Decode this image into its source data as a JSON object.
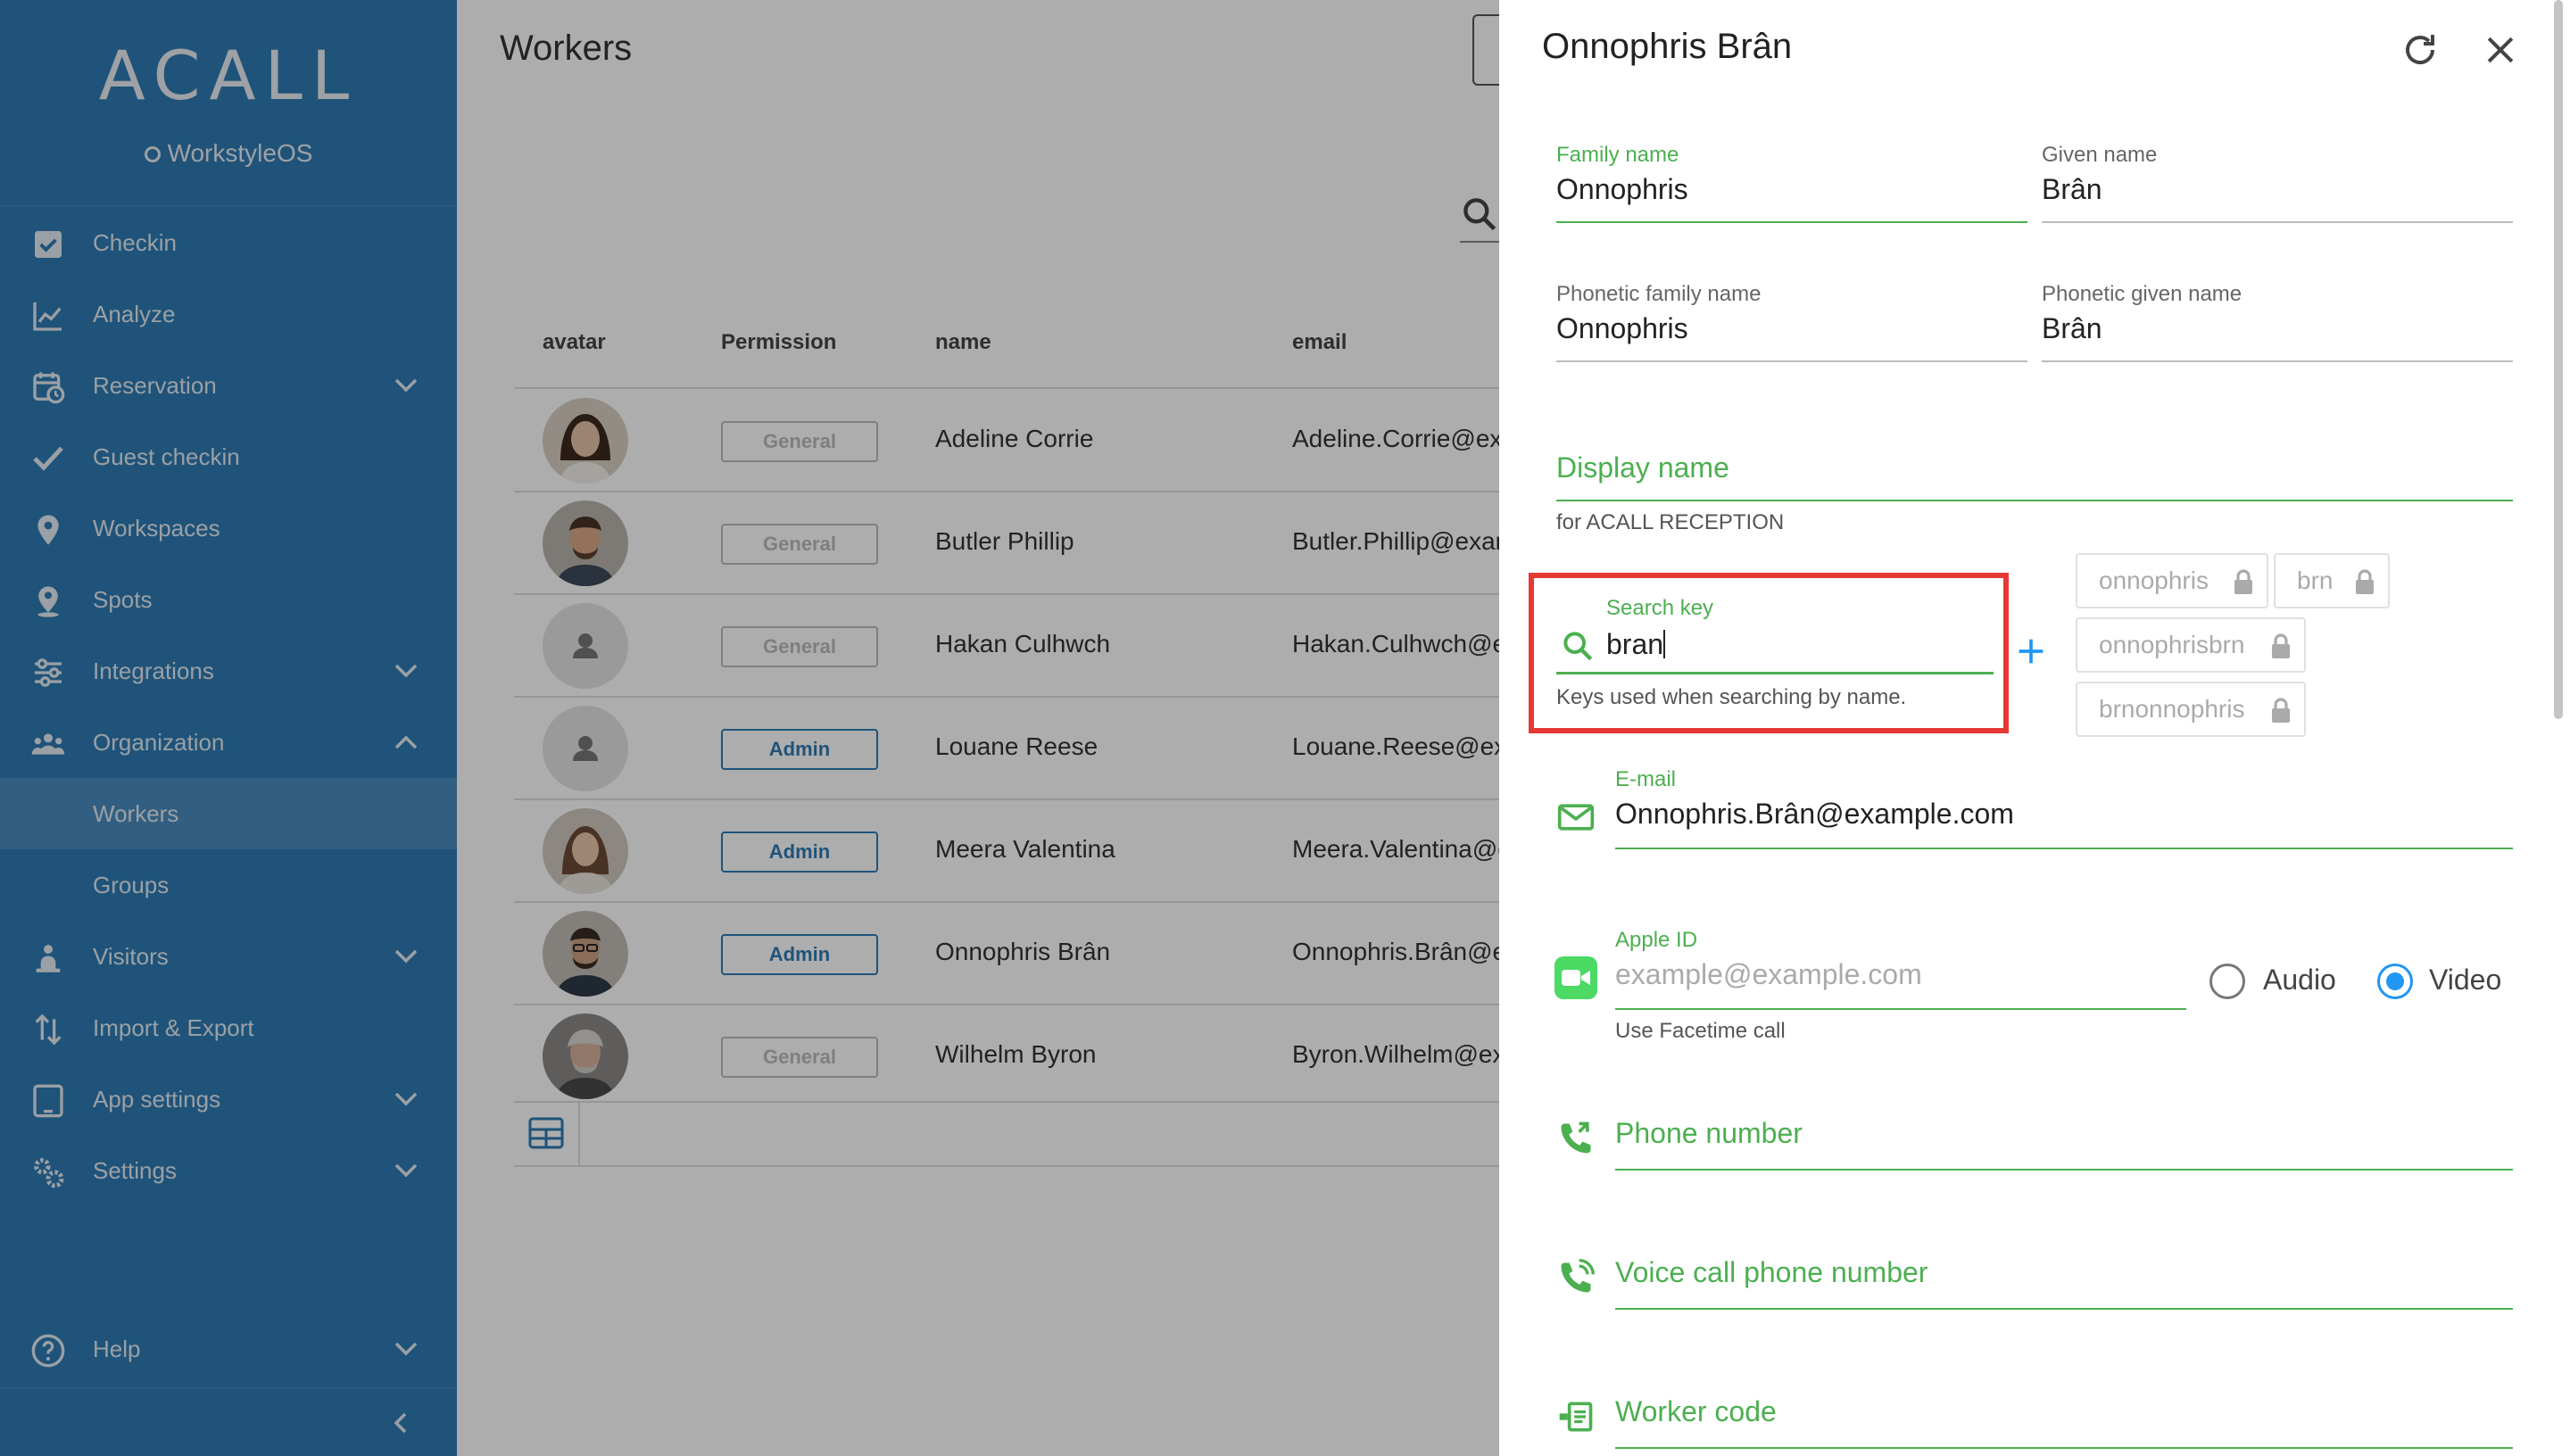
{
  "sidebar": {
    "logo": "ACALL",
    "subbrand": "WorkstyleOS",
    "items": [
      {
        "label": "Checkin",
        "icon": "checkbox-icon"
      },
      {
        "label": "Analyze",
        "icon": "chart-icon"
      },
      {
        "label": "Reservation",
        "icon": "calendar-clock-icon"
      },
      {
        "label": "Guest checkin",
        "icon": "check-icon"
      },
      {
        "label": "Workspaces",
        "icon": "pin-icon"
      },
      {
        "label": "Spots",
        "icon": "person-pin-icon"
      },
      {
        "label": "Integrations",
        "icon": "sliders-icon"
      },
      {
        "label": "Organization",
        "icon": "people-icon"
      },
      {
        "label": "Workers",
        "icon": ""
      },
      {
        "label": "Groups",
        "icon": ""
      },
      {
        "label": "Visitors",
        "icon": "visitor-icon"
      },
      {
        "label": "Import & Export",
        "icon": "import-export-icon"
      },
      {
        "label": "App settings",
        "icon": "tablet-icon"
      },
      {
        "label": "Settings",
        "icon": "gears-icon"
      },
      {
        "label": "Help",
        "icon": "help-icon"
      }
    ]
  },
  "main": {
    "title": "Workers",
    "columns": {
      "avatar": "avatar",
      "permission": "Permission",
      "name": "name",
      "email": "email"
    },
    "rows": [
      {
        "permission": "General",
        "name": "Adeline Corrie",
        "email": "Adeline.Corrie@ex"
      },
      {
        "permission": "General",
        "name": "Butler Phillip",
        "email": "Butler.Phillip@exar"
      },
      {
        "permission": "General",
        "name": "Hakan Culhwch",
        "email": "Hakan.Culhwch@e"
      },
      {
        "permission": "Admin",
        "name": "Louane Reese",
        "email": "Louane.Reese@ex"
      },
      {
        "permission": "Admin",
        "name": "Meera Valentina",
        "email": "Meera.Valentina@e"
      },
      {
        "permission": "Admin",
        "name": "Onnophris Brân",
        "email": "Onnophris.Brân@e"
      },
      {
        "permission": "General",
        "name": "Wilhelm Byron",
        "email": "Byron.Wilhelm@ex"
      }
    ]
  },
  "panel": {
    "title": "Onnophris Brân",
    "family_name": {
      "label": "Family name",
      "value": "Onnophris"
    },
    "given_name": {
      "label": "Given name",
      "value": "Brân"
    },
    "phonetic_family": {
      "label": "Phonetic family name",
      "value": "Onnophris"
    },
    "phonetic_given": {
      "label": "Phonetic given name",
      "value": "Brân"
    },
    "display_name": {
      "placeholder": "Display name",
      "helper": "for ACALL RECEPTION"
    },
    "search_key": {
      "label": "Search key",
      "value": "bran",
      "helper": "Keys used when searching by name."
    },
    "keys": [
      "onnophris",
      "brn",
      "onnophrisbrn",
      "brnonnophris"
    ],
    "email": {
      "label": "E-mail",
      "value": "Onnophris.Brân@example.com"
    },
    "apple_id": {
      "label": "Apple ID",
      "placeholder": "example@example.com",
      "helper": "Use Facetime call"
    },
    "call_type": {
      "audio": "Audio",
      "video": "Video",
      "selected": "Video"
    },
    "phone": {
      "placeholder": "Phone number"
    },
    "voice_phone": {
      "placeholder": "Voice call phone number"
    },
    "worker_code": {
      "placeholder": "Worker code"
    }
  },
  "colors": {
    "sidebar": "#2f7bb3",
    "accent_green": "#4caf50",
    "highlight": "#e53935",
    "radio": "#2196f3"
  }
}
